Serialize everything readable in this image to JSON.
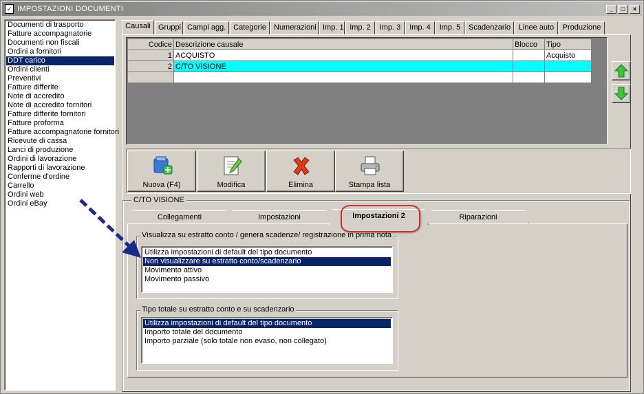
{
  "window": {
    "title": "IMPOSTAZIONI DOCUMENTI",
    "controls": {
      "minimize": "_",
      "maximize": "□",
      "close": "×"
    }
  },
  "sidebar": {
    "items": [
      "Documenti di trasporto",
      "Fatture accompagnatorie",
      "Documenti non fiscali",
      "Ordini a fornitori",
      "DDT carico",
      "Ordini clienti",
      "Preventivi",
      "Fatture differite",
      "Note di accredito",
      "Note di accredito fornitori",
      "Fatture differite fornitori",
      "Fatture proforma",
      "Fatture accompagnatorie fornitori",
      "Ricevute di cassa",
      "Lanci di produzione",
      "Ordini di lavorazione",
      "Rapporti di lavorazione",
      "Conferme d'ordine",
      "Carrello",
      "Ordini web",
      "Ordini eBay"
    ],
    "selected": "DDT carico"
  },
  "tabs": [
    "Causali",
    "Gruppi",
    "Campi agg.",
    "Categorie",
    "Numerazioni",
    "Imp. 1",
    "Imp. 2",
    "Imp. 3",
    "Imp. 4",
    "Imp. 5",
    "Scadenzario",
    "Linee auto",
    "Produzione"
  ],
  "active_tab": "Causali",
  "grid": {
    "columns": [
      "Codice",
      "Descrizione causale",
      "Blocco",
      "Tipo"
    ],
    "rows": [
      {
        "codice": "1",
        "descrizione": "ACQUISTO",
        "blocco": "",
        "tipo": "Acquisto"
      },
      {
        "codice": "2",
        "descrizione": "C/TO VISIONE",
        "blocco": "",
        "tipo": ""
      },
      {
        "codice": "",
        "descrizione": "",
        "blocco": "",
        "tipo": ""
      }
    ],
    "highlight_color": "#00ffff"
  },
  "side_buttons": {
    "up_icon": "green-up-arrow-icon",
    "down_icon": "green-down-arrow-icon"
  },
  "toolbar": {
    "new_label": "Nuova (F4)",
    "edit_label": "Modifica",
    "delete_label": "Elimina",
    "print_label": "Stampa lista"
  },
  "detail": {
    "group_title": "C/TO VISIONE",
    "subtabs": [
      "Collegamenti",
      "Impostazioni",
      "Impostazioni 2",
      "Riparazioni"
    ],
    "active_subtab": "Impostazioni 2",
    "box1": {
      "title": "Visualizza su estratto conto / genera scadenze/ registrazione  in prima nota",
      "options": [
        "Utilizza impostazioni di default del tipo documento",
        "Non visualizzare su estratto conto/scadenzario",
        "Movimento attivo",
        "Movimento passivo"
      ],
      "selected": "Non visualizzare su estratto conto/scadenzario"
    },
    "box2": {
      "title": "Tipo totale su estratto conto e su scadenzario",
      "options": [
        "Utilizza impostazioni di default del tipo documento",
        "Importo totale del documento",
        "Importo parziale (solo totale non evaso, non collegato)"
      ],
      "selected": "Utilizza impostazioni di default del tipo documento"
    }
  },
  "annotation": {
    "arrow_color": "#1a2a8a",
    "oval_color": "#c8302a"
  }
}
